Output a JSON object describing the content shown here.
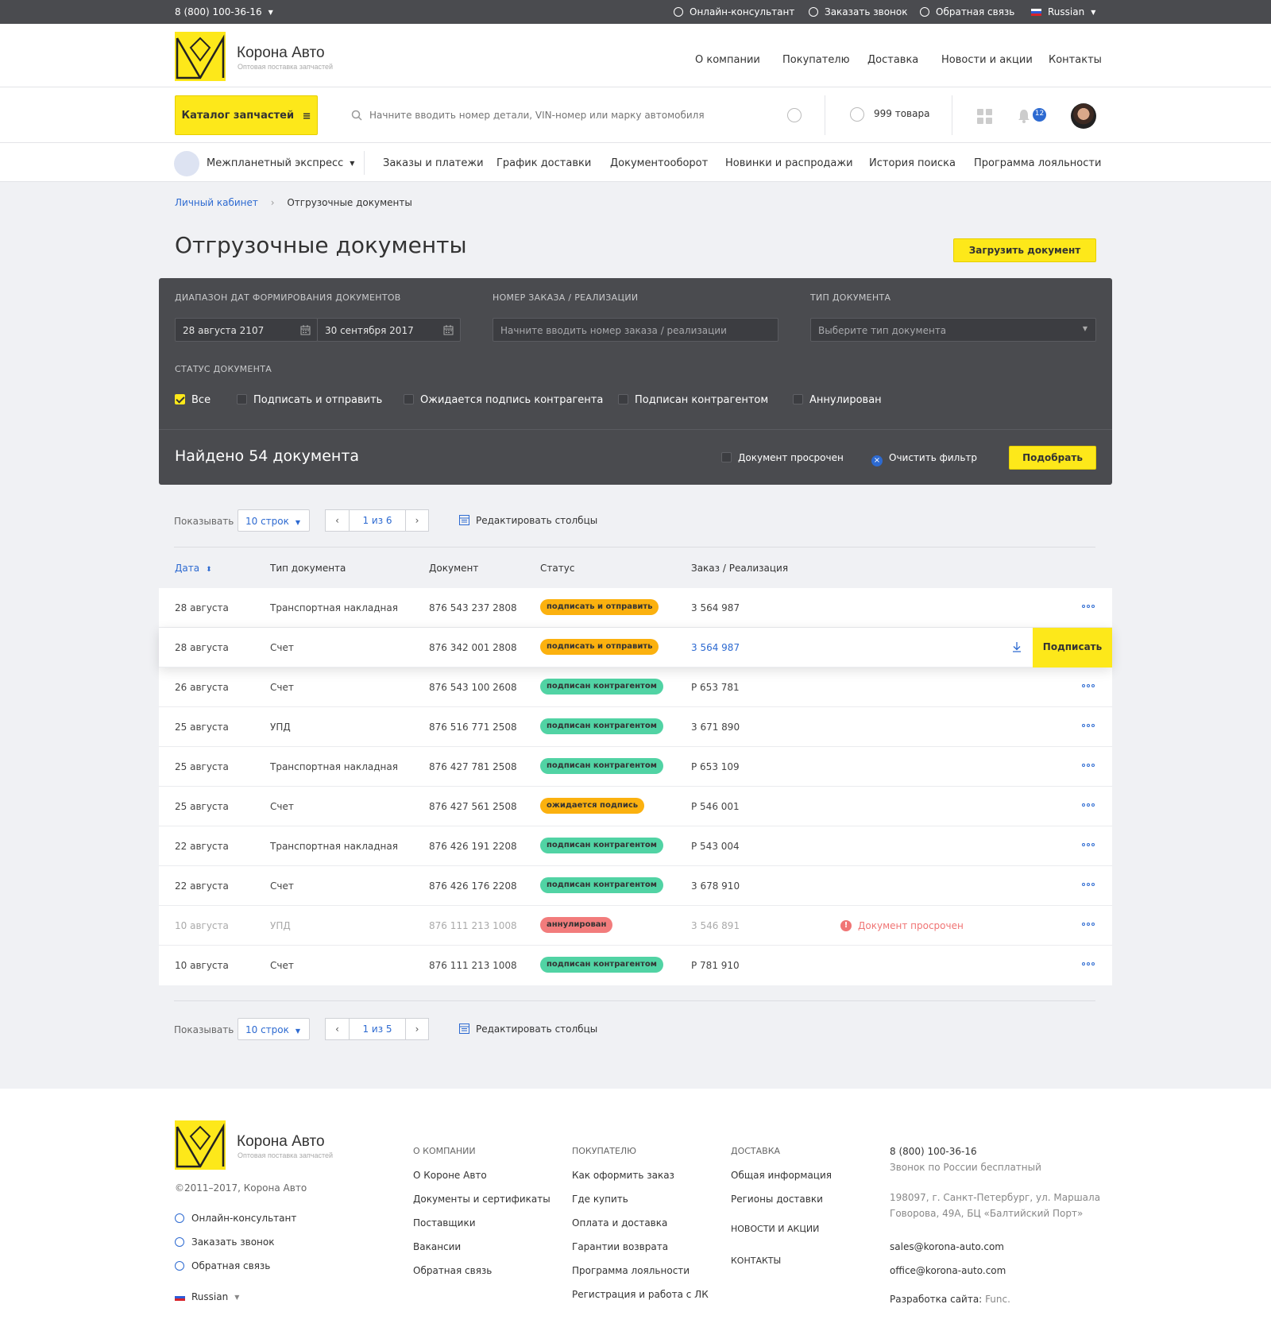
{
  "topbar": {
    "phone": "8 (800) 100-36-16",
    "links": [
      "Онлайн-консультант",
      "Заказать звонок",
      "Обратная связь"
    ],
    "lang": "Russian"
  },
  "brand": {
    "name": "Корона Авто",
    "tagline": "Оптовая поставка запчастей"
  },
  "main_nav": [
    "О компании",
    "Покупателю",
    "Доставка",
    "Новости и акции",
    "Контакты"
  ],
  "toolbar": {
    "catalog": "Каталог запчастей",
    "search_placeholder": "Начните вводить номер детали, VIN-номер или марку автомобиля",
    "cart": "999 товара",
    "notifications": "12"
  },
  "account_nav": {
    "company": "Межпланетный экспресс",
    "items": [
      "Заказы и платежи",
      "График доставки",
      "Документооборот",
      "Новинки и распродажи",
      "История поиска",
      "Программа лояльности"
    ]
  },
  "breadcrumb": {
    "root": "Личный кабинет",
    "sep": "›",
    "current": "Отгрузочные документы"
  },
  "page": {
    "title": "Отгрузочные документы",
    "upload": "Загрузить документ"
  },
  "filter": {
    "date_label": "Диапазон дат формирования документов",
    "date_from": "28 августа 2107",
    "date_to": "30 сентября 2017",
    "order_label": "Номер заказа / реализации",
    "order_placeholder": "Начните вводить номер заказа / реализации",
    "type_label": "Тип документа",
    "type_placeholder": "Выберите тип документа",
    "status_label": "Статус документа",
    "statuses": [
      {
        "label": "Все",
        "checked": true
      },
      {
        "label": "Подписать и отправить",
        "checked": false
      },
      {
        "label": "Ожидается подпись контрагента",
        "checked": false
      },
      {
        "label": "Подписан контрагентом",
        "checked": false
      },
      {
        "label": "Аннулирован",
        "checked": false
      }
    ],
    "found": "Найдено 54 документа",
    "overdue": "Документ просрочен",
    "clear": "Очистить фильтр",
    "apply": "Подобрать"
  },
  "pager_top": {
    "show": "Показывать",
    "rows": "10 строк",
    "page": "1 из 6",
    "edit_cols": "Редактировать столбцы"
  },
  "pager_bottom": {
    "show": "Показывать",
    "rows": "10 строк",
    "page": "1 из 5",
    "edit_cols": "Редактировать столбцы"
  },
  "columns": [
    "Дата",
    "Тип документа",
    "Документ",
    "Статус",
    "Заказ / Реализация"
  ],
  "rows": [
    {
      "date": "28 августа",
      "type": "Транспортная накладная",
      "doc": "876 543 237 2808",
      "status": "подписать и отправить",
      "tone": "y",
      "order": "3 564 987"
    },
    {
      "date": "28 августа",
      "type": "Счет",
      "doc": "876 342 001 2808",
      "status": "подписать и отправить",
      "tone": "y",
      "order": "3 564 987",
      "action": "Подписать"
    },
    {
      "date": "26 августа",
      "type": "Счет",
      "doc": "876 543 100 2608",
      "status": "подписан контрагентом",
      "tone": "g",
      "order": "Р 653 781"
    },
    {
      "date": "25 августа",
      "type": "УПД",
      "doc": "876 516 771 2508",
      "status": "подписан контрагентом",
      "tone": "g",
      "order": "3 671 890"
    },
    {
      "date": "25 августа",
      "type": "Транспортная накладная",
      "doc": "876 427 781 2508",
      "status": "подписан контрагентом",
      "tone": "g",
      "order": "Р 653 109"
    },
    {
      "date": "25 августа",
      "type": "Счет",
      "doc": "876 427 561 2508",
      "status": "ожидается подпись",
      "tone": "y",
      "order": "Р 546 001"
    },
    {
      "date": "22 августа",
      "type": "Транспортная накладная",
      "doc": "876 426 191 2208",
      "status": "подписан контрагентом",
      "tone": "g",
      "order": "Р 543 004"
    },
    {
      "date": "22 августа",
      "type": "Счет",
      "doc": "876 426 176 2208",
      "status": "подписан контрагентом",
      "tone": "g",
      "order": "3 678 910"
    },
    {
      "date": "10 августа",
      "type": "УПД",
      "doc": "876 111 213 1008",
      "status": "аннулирован",
      "tone": "r",
      "order": "3 546 891",
      "note": "Документ просрочен"
    },
    {
      "date": "10 августа",
      "type": "Счет",
      "doc": "876 111 213 1008",
      "status": "подписан контрагентом",
      "tone": "g",
      "order": "Р 781 910"
    }
  ],
  "footer": {
    "copyright": "©2011–2017, Корона Авто",
    "links": [
      "Онлайн-консультант",
      "Заказать звонок",
      "Обратная связь"
    ],
    "lang": "Russian",
    "col1": {
      "title": "О компании",
      "items": [
        "О Короне Авто",
        "Документы и сертификаты",
        "Поставщики",
        "Вакансии",
        "Обратная связь"
      ]
    },
    "col2": {
      "title": "Покупателю",
      "items": [
        "Как оформить заказ",
        "Где купить",
        "Оплата и доставка",
        "Гарантии возврата",
        "Программа лояльности",
        "Регистрация и работа с ЛК"
      ]
    },
    "col3": {
      "title": "Доставка",
      "items": [
        "Общая информация",
        "Регионы доставки"
      ],
      "news": "Новости и акции",
      "contacts": "Контакты"
    },
    "contact": {
      "phone": "8 (800) 100-36-16",
      "phone_note": "Звонок по России бесплатный",
      "address1": "198097, г. Санкт-Петербург, ул. Маршала",
      "address2": "Говорова, 49А, БЦ «Балтийский Порт»",
      "email1": "sales@korona-auto.com",
      "email2": "office@korona-auto.com",
      "dev_label": "Разработка сайта:",
      "dev": "Func."
    }
  },
  "colors": {
    "accent": "#fde81a",
    "link": "#2d6ad1",
    "dark": "#4a4b4f",
    "badge_yellow": "#fbb10f",
    "badge_green": "#51d3a4",
    "badge_red": "#f27c7c"
  }
}
